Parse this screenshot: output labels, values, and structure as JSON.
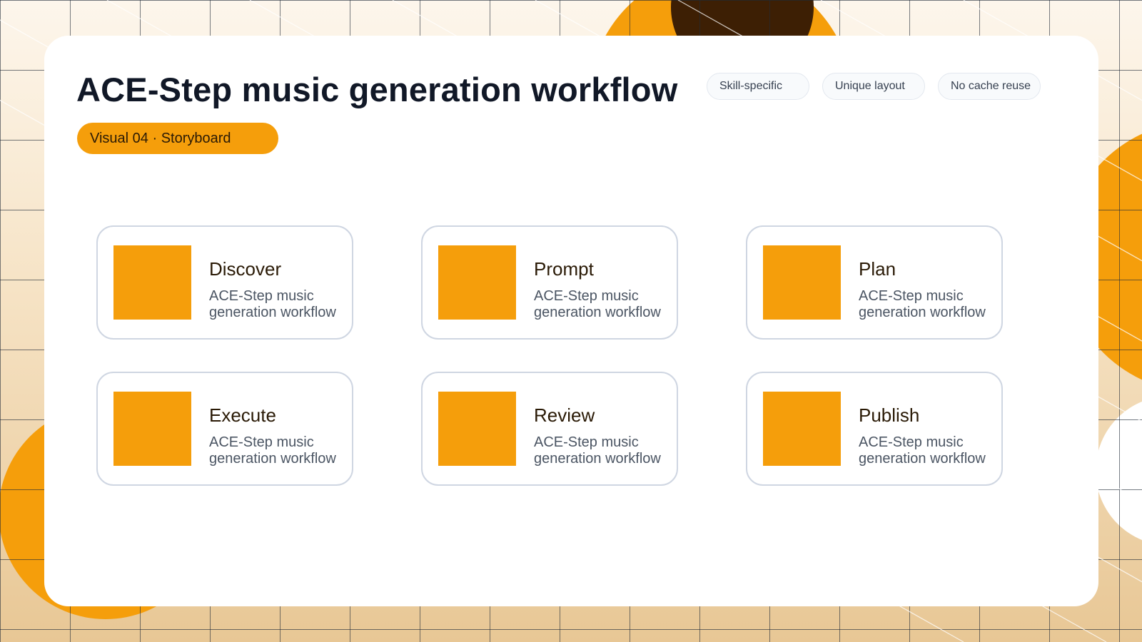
{
  "title": "ACE-Step music generation workflow",
  "badge": "Visual 04 · Storyboard",
  "tags": [
    "Skill-specific",
    "Unique layout",
    "No cache reuse"
  ],
  "steps": [
    {
      "label": "Discover",
      "description": "ACE-Step music generation workflow"
    },
    {
      "label": "Prompt",
      "description": "ACE-Step music generation workflow"
    },
    {
      "label": "Plan",
      "description": "ACE-Step music generation workflow"
    },
    {
      "label": "Execute",
      "description": "ACE-Step music generation workflow"
    },
    {
      "label": "Review",
      "description": "ACE-Step music generation workflow"
    },
    {
      "label": "Publish",
      "description": "ACE-Step music generation workflow"
    }
  ],
  "colors": {
    "accent": "#f59e0b",
    "dark_accent": "#3d1f04",
    "title_text": "#111827",
    "card_bg": "#ffffff",
    "border": "#cfd6e2"
  }
}
